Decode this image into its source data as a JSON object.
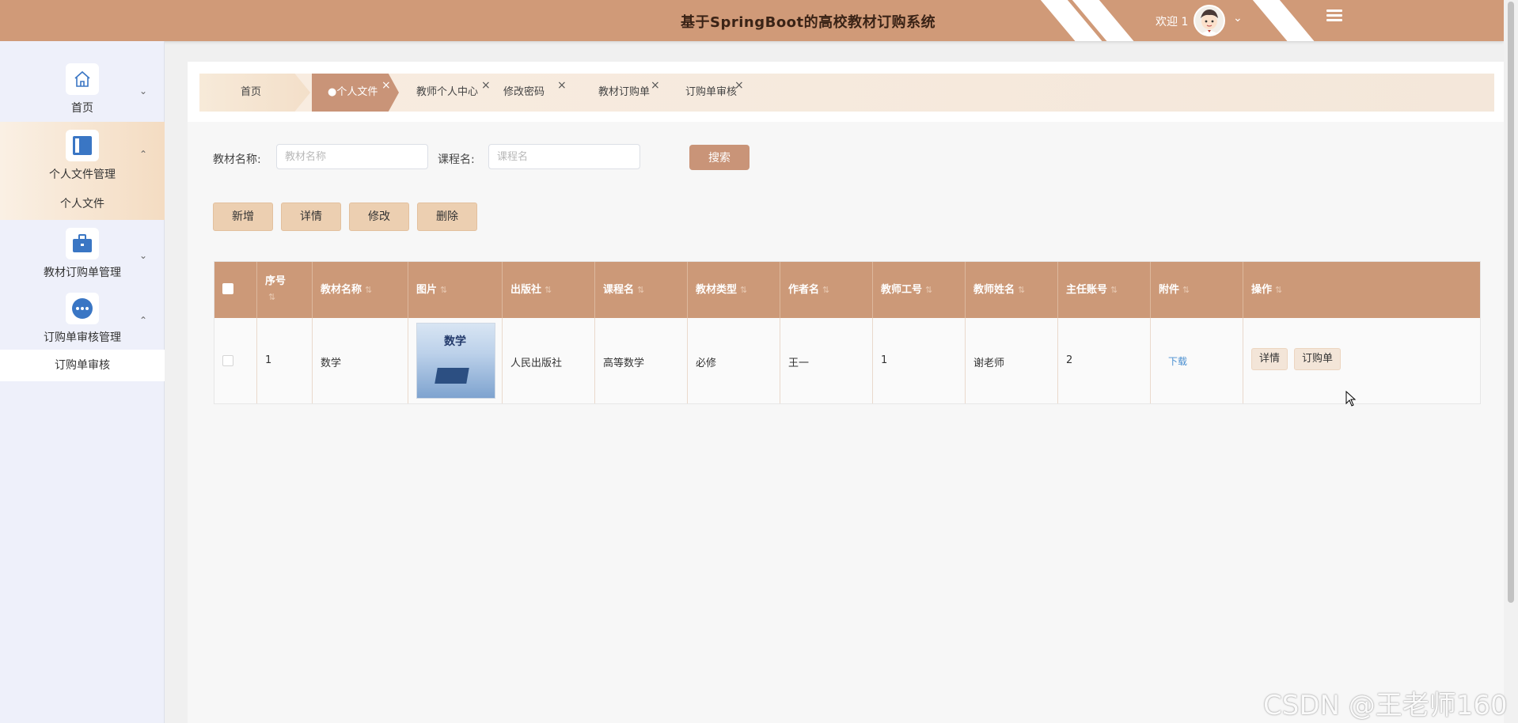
{
  "header": {
    "title": "基于SpringBoot的高校教材订购系统",
    "welcome": "欢迎 1",
    "accent": "#d09a78"
  },
  "sidebar": {
    "items": [
      {
        "label": "首页",
        "icon": "home-icon"
      },
      {
        "label": "个人文件管理",
        "icon": "document-panel-icon",
        "sub": [
          "个人文件"
        ]
      },
      {
        "label": "教材订购单管理",
        "icon": "briefcase-icon"
      },
      {
        "label": "订购单审核管理",
        "icon": "dots-circle-icon",
        "sub": [
          "订购单审核"
        ]
      }
    ]
  },
  "tabs": [
    {
      "label": "首页"
    },
    {
      "label": "●个人文件"
    },
    {
      "label": "教师个人中心"
    },
    {
      "label": "修改密码"
    },
    {
      "label": "教材订购单"
    },
    {
      "label": "订购单审核"
    }
  ],
  "search": {
    "label_1": "教材名称:",
    "placeholder_1": "教材名称",
    "label_2": "课程名:",
    "placeholder_2": "课程名",
    "button": "搜索"
  },
  "actions": {
    "add": "新增",
    "detail": "详情",
    "edit": "修改",
    "delete": "删除"
  },
  "table": {
    "columns": [
      "序号",
      "教材名称",
      "图片",
      "出版社",
      "课程名",
      "教材类型",
      "作者名",
      "教师工号",
      "教师姓名",
      "主任账号",
      "附件",
      "操作"
    ],
    "rows": [
      {
        "index": "1",
        "name": "数学",
        "image_text": "数学",
        "publisher": "人民出版社",
        "course": "高等数学",
        "type": "必修",
        "author": "王一",
        "teacher_id": "1",
        "teacher_name": "谢老师",
        "director": "2",
        "attachment": "下载",
        "op_detail": "详情",
        "op_order": "订购单"
      }
    ]
  },
  "watermark": "CSDN @王老师160"
}
